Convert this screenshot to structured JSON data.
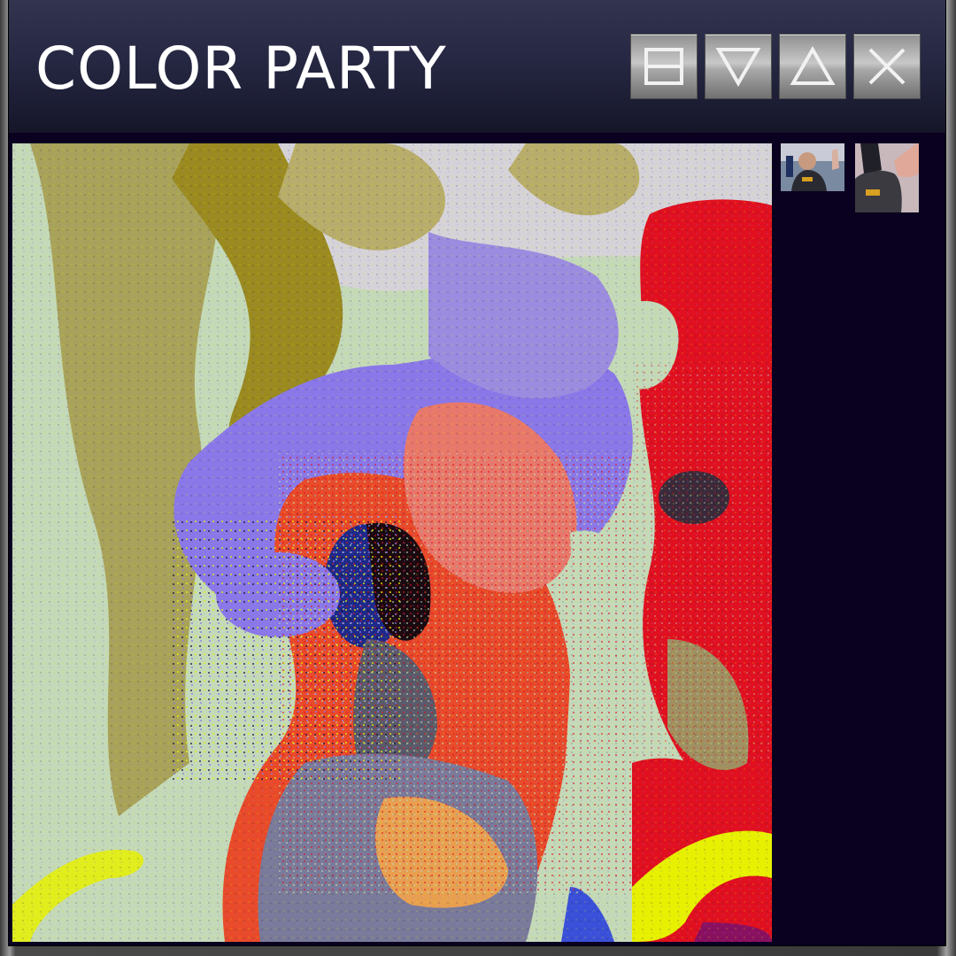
{
  "window": {
    "title": "COLOR PARTY",
    "controls": [
      {
        "name": "layout-button",
        "icon": "split-layout-icon"
      },
      {
        "name": "down-button",
        "icon": "triangle-down-icon"
      },
      {
        "name": "up-button",
        "icon": "triangle-up-icon"
      },
      {
        "name": "close-button",
        "icon": "close-icon"
      }
    ]
  },
  "video": {
    "main_feed": "color-party-filtered-feed",
    "thumbnails": [
      {
        "name": "participant-thumbnail-1"
      },
      {
        "name": "participant-thumbnail-2"
      }
    ]
  },
  "colors": {
    "titlebar_top": "#33344f",
    "titlebar_bottom": "#151629",
    "panel_bg": "#0a0020",
    "feed_red": "#e01020",
    "feed_orange": "#e84a2a",
    "feed_lavender": "#8a78e8",
    "feed_olive": "#9a8a20",
    "feed_mint": "#c4d9b8",
    "feed_yellow": "#e6f000"
  }
}
